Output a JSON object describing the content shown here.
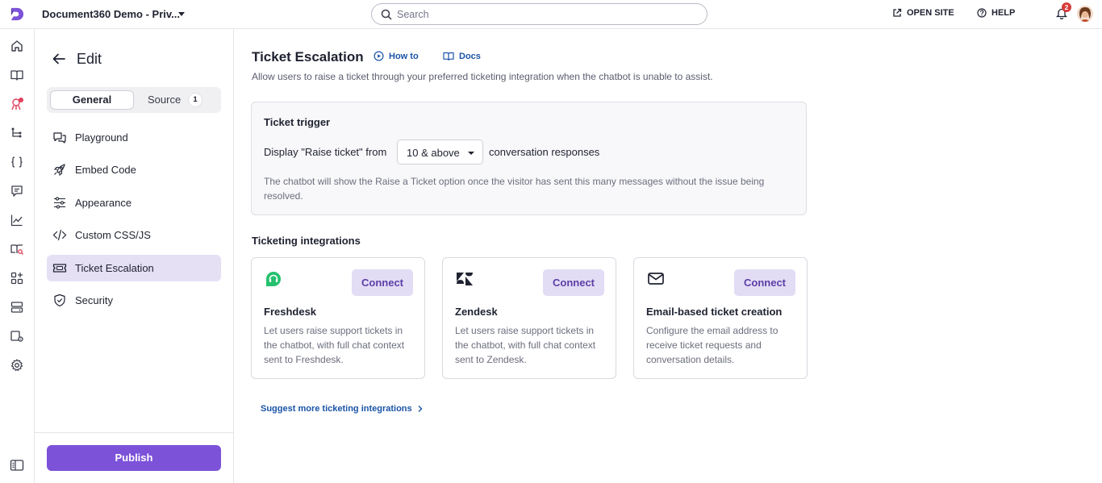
{
  "topbar": {
    "project_name": "Document360 Demo - Priv...",
    "search_placeholder": "Search",
    "open_site_label": "OPEN SITE",
    "help_label": "HELP",
    "notification_count": "2"
  },
  "rail": {
    "icons": [
      "home-icon",
      "book-icon",
      "bot-icon",
      "tree-icon",
      "braces-icon",
      "comment-icon",
      "analytics-icon",
      "book-search-icon",
      "apps-icon",
      "drive-icon",
      "settings-book-icon",
      "gear-icon",
      "sidebar-toggle-icon"
    ]
  },
  "panel": {
    "title": "Edit",
    "tabs": {
      "general": "General",
      "source": "Source",
      "source_count": "1"
    },
    "nav": [
      {
        "label": "Playground",
        "icon": "chat-bubbles-icon"
      },
      {
        "label": "Embed Code",
        "icon": "rocket-icon"
      },
      {
        "label": "Appearance",
        "icon": "sliders-icon"
      },
      {
        "label": "Custom CSS/JS",
        "icon": "code-icon"
      },
      {
        "label": "Ticket Escalation",
        "icon": "ticket-icon",
        "active": true
      },
      {
        "label": "Security",
        "icon": "shield-icon"
      }
    ],
    "publish_label": "Publish"
  },
  "main": {
    "title": "Ticket Escalation",
    "how_to_label": "How to",
    "docs_label": "Docs",
    "subtitle": "Allow users to raise a ticket through your preferred ticketing integration when the chatbot is unable to assist.",
    "trigger": {
      "title": "Ticket trigger",
      "pre_text": "Display \"Raise ticket\" from",
      "select_value": "10 & above",
      "post_text": "conversation responses",
      "help": "The chatbot will show the Raise a Ticket option once the visitor has sent this many messages without the issue being resolved."
    },
    "integrations_title": "Ticketing integrations",
    "integrations": [
      {
        "name": "Freshdesk",
        "connect_label": "Connect",
        "description": "Let users raise support tickets in the chatbot, with full chat context sent to Freshdesk.",
        "icon": "freshdesk-logo-icon"
      },
      {
        "name": "Zendesk",
        "connect_label": "Connect",
        "description": "Let users raise support tickets in the chatbot, with full chat context sent to Zendesk.",
        "icon": "zendesk-logo-icon"
      },
      {
        "name": "Email-based ticket creation",
        "connect_label": "Connect",
        "description": "Configure the email address to receive ticket requests and conversation details.",
        "icon": "envelope-icon"
      }
    ],
    "suggest_label": "Suggest more ticketing integrations"
  },
  "colors": {
    "accent": "#7c52d8",
    "active_nav_bg": "#e6e0f5",
    "link": "#1a54a6",
    "freshdesk": "#25c16f"
  }
}
